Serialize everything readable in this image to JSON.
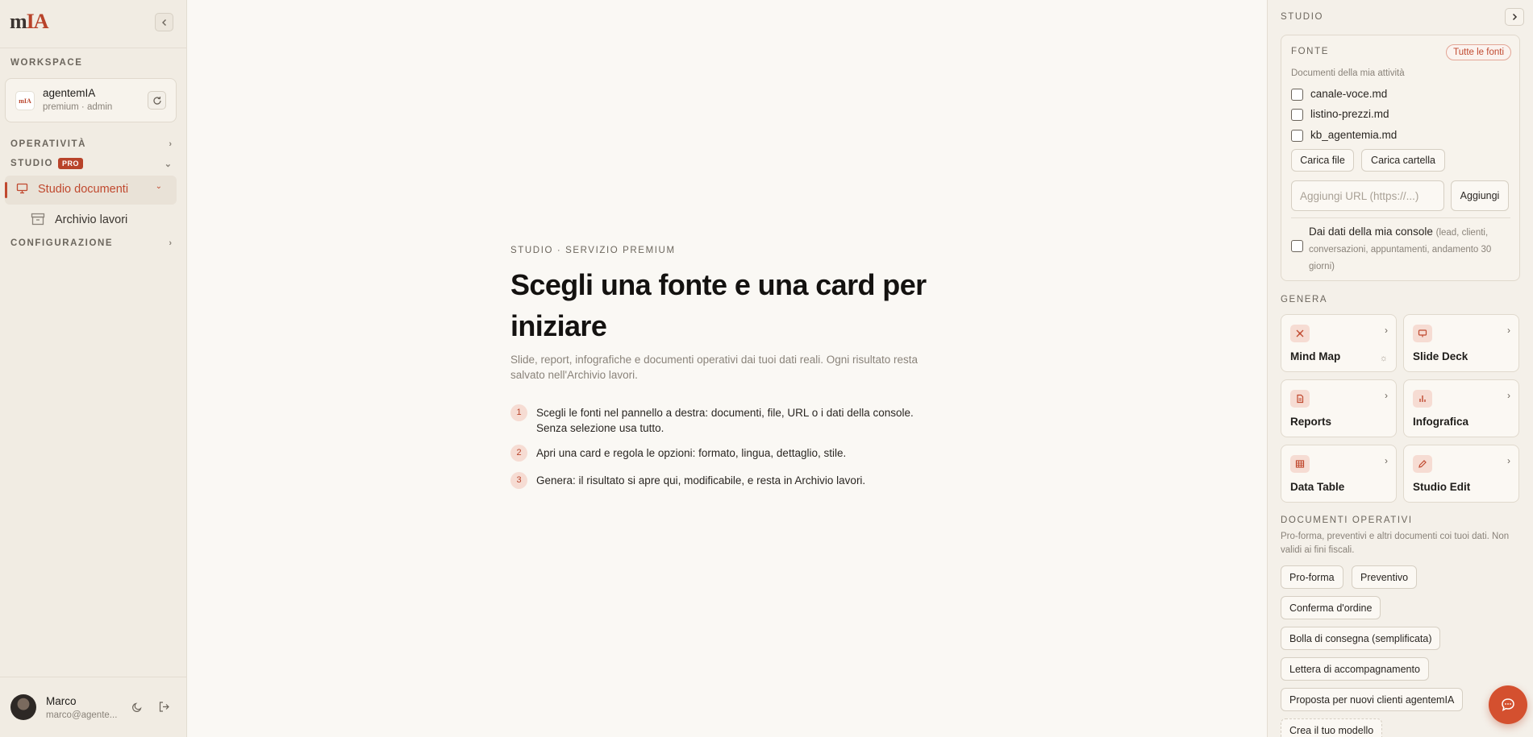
{
  "sidebar": {
    "logo": {
      "m": "m",
      "ia": "IA"
    },
    "workspace_label": "WORKSPACE",
    "workspace": {
      "logo_text": "mIA",
      "name": "agentemIA",
      "subtitle": "premium · admin"
    },
    "groups": {
      "operativita": "OPERATIVITÀ",
      "studio": "STUDIO",
      "studio_badge": "PRO",
      "configurazione": "CONFIGURAZIONE"
    },
    "items": [
      {
        "label": "Studio documenti",
        "icon": "presentation-icon",
        "active": true
      },
      {
        "label": "Archivio lavori",
        "icon": "archive-icon",
        "active": false
      }
    ],
    "user": {
      "name": "Marco",
      "email": "marco@agente..."
    }
  },
  "main": {
    "kicker": "STUDIO · SERVIZIO PREMIUM",
    "headline": "Scegli una fonte e una card per iniziare",
    "subline": "Slide, report, infografiche e documenti operativi dai tuoi dati reali. Ogni risultato resta salvato nell'Archivio lavori.",
    "steps": [
      {
        "num": "1",
        "text": "Scegli le fonti nel pannello a destra: documenti, file, URL o i dati della console. Senza selezione usa tutto."
      },
      {
        "num": "2",
        "text": "Apri una card e regola le opzioni: formato, lingua, dettaglio, stile."
      },
      {
        "num": "3",
        "text": "Genera: il risultato si apre qui, modificabile, e resta in Archivio lavori."
      }
    ]
  },
  "panel": {
    "title": "STUDIO",
    "source": {
      "label": "FONTE",
      "all_button": "Tutte le fonti",
      "caption": "Documenti della mia attività",
      "files": [
        "canale-voce.md",
        "listino-prezzi.md",
        "kb_agentemia.md"
      ],
      "upload_file": "Carica file",
      "upload_folder": "Carica cartella",
      "url_placeholder": "Aggiungi URL (https://...)",
      "add_button": "Aggiungi",
      "console_label": "Dai dati della mia console",
      "console_detail": "(lead, clienti, conversazioni, appuntamenti, andamento 30 giorni)"
    },
    "generate_label": "GENERA",
    "cards": [
      {
        "label": "Mind Map",
        "icon": "mindmap-icon"
      },
      {
        "label": "Slide Deck",
        "icon": "presentation-icon"
      },
      {
        "label": "Reports",
        "icon": "document-icon"
      },
      {
        "label": "Infografica",
        "icon": "bar-chart-icon"
      },
      {
        "label": "Data Table",
        "icon": "table-icon"
      },
      {
        "label": "Studio Edit",
        "icon": "pencil-icon"
      }
    ],
    "ops_label": "DOCUMENTI OPERATIVI",
    "ops_desc": "Pro-forma, preventivi e altri documenti coi tuoi dati. Non validi ai fini fiscali.",
    "ops_chips": [
      "Pro-forma",
      "Preventivo",
      "Conferma d'ordine",
      "Bolla di consegna (semplificata)",
      "Lettera di accompagnamento",
      "Proposta per nuovi clienti agentemIA",
      "Crea il tuo modello"
    ]
  },
  "colors": {
    "accent": "#c0492f",
    "sidebar_bg": "#f1ece3",
    "page_bg": "#faf8f4",
    "fab": "#d4502f"
  }
}
